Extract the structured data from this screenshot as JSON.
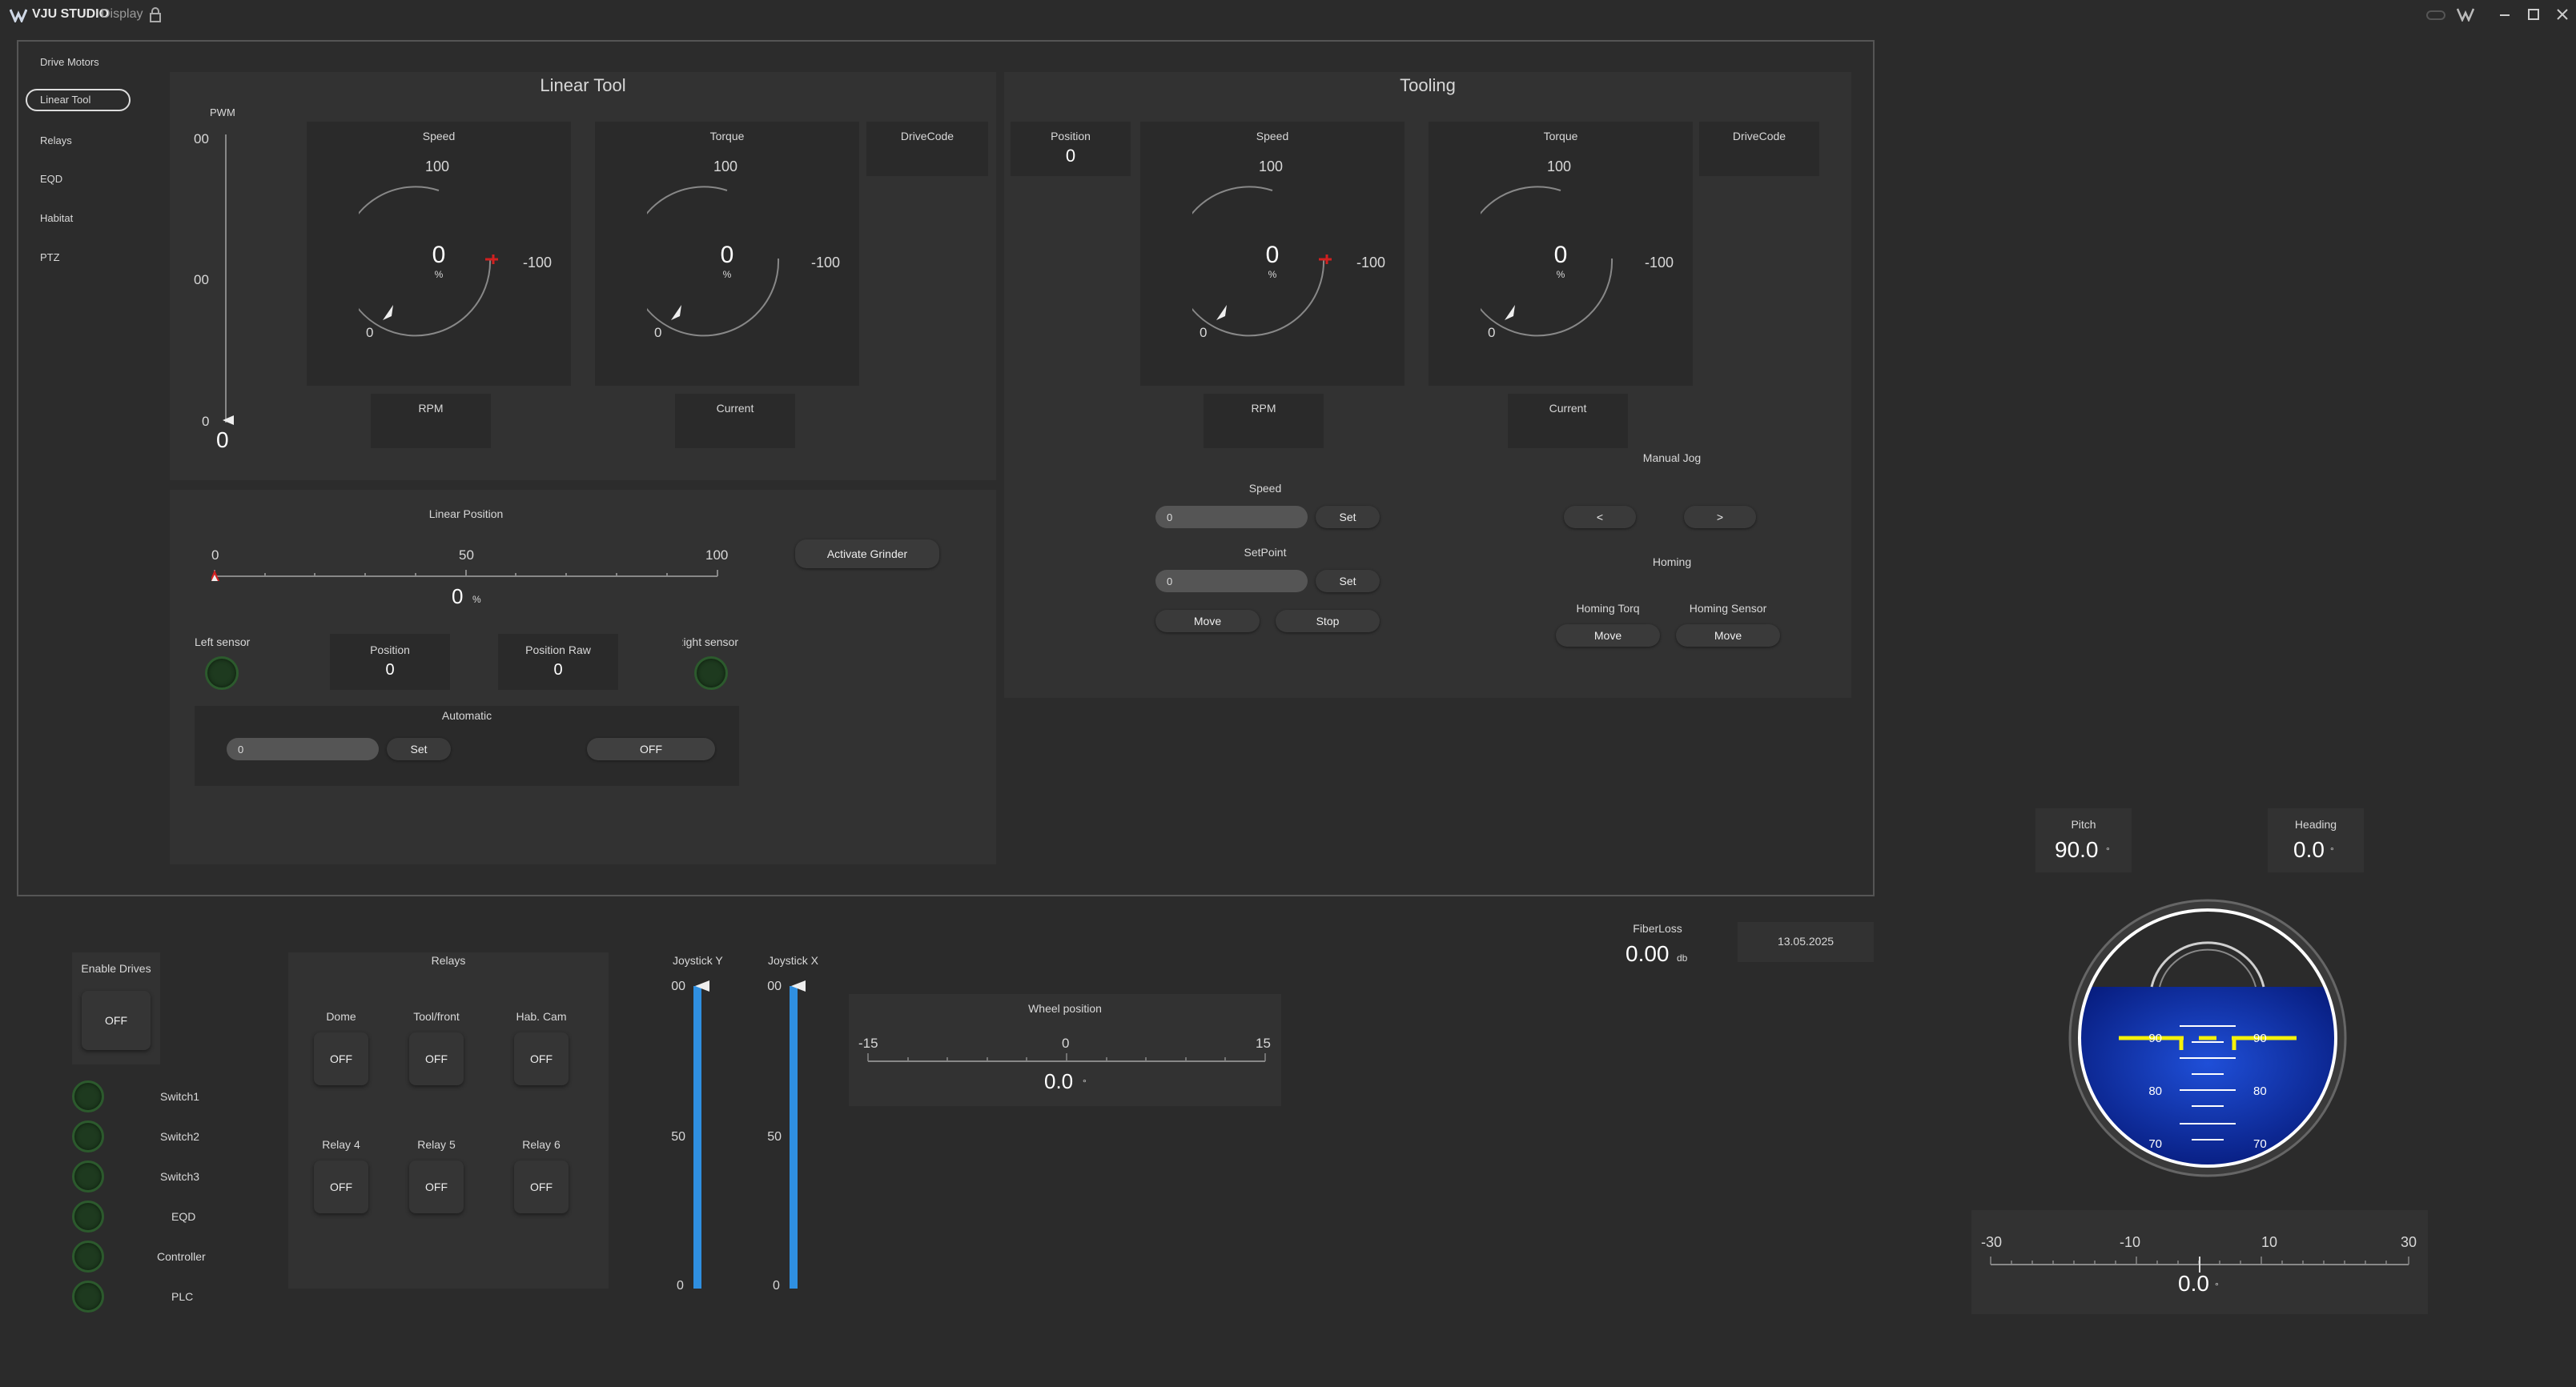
{
  "titlebar": {
    "app": "VJU STUDIO",
    "mode": "Display"
  },
  "sidebar": {
    "items": [
      {
        "label": "Drive Motors"
      },
      {
        "label": "Linear Tool"
      },
      {
        "label": "Relays"
      },
      {
        "label": "EQD"
      },
      {
        "label": "Habitat"
      },
      {
        "label": "PTZ"
      }
    ]
  },
  "linear_tool": {
    "title": "Linear Tool",
    "pwm": {
      "label": "PWM",
      "ticks": [
        "00",
        "00",
        "0"
      ],
      "value": "0"
    },
    "speed": {
      "label": "Speed",
      "max": "100",
      "min": "0",
      "neg": "-100",
      "value": "0",
      "unit": "%",
      "fraction": 0
    },
    "torque": {
      "label": "Torque",
      "max": "100",
      "min": "0",
      "neg": "-100",
      "value": "0",
      "unit": "%",
      "fraction": 0
    },
    "drivecode_label": "DriveCode",
    "rpm_label": "RPM",
    "current_label": "Current",
    "linear_position": {
      "label": "Linear Position",
      "ticks": [
        "0",
        "50",
        "100"
      ],
      "value": "0",
      "unit": "%",
      "fraction": 0
    },
    "activate_grinder": "Activate Grinder",
    "left_sensor": "Left sensor",
    "right_sensor": "Right sensor",
    "position": {
      "label": "Position",
      "value": "0"
    },
    "position_raw": {
      "label": "Position Raw",
      "value": "0"
    },
    "automatic": {
      "label": "Automatic",
      "input": "0",
      "set": "Set",
      "toggle": "OFF"
    }
  },
  "tooling": {
    "title": "Tooling",
    "position": {
      "label": "Position",
      "value": "0"
    },
    "speed": {
      "label": "Speed",
      "max": "100",
      "min": "0",
      "neg": "-100",
      "value": "0",
      "unit": "%",
      "fraction": 0
    },
    "torque": {
      "label": "Torque",
      "max": "100",
      "min": "0",
      "neg": "-100",
      "value": "0",
      "unit": "%",
      "fraction": 0
    },
    "drivecode_label": "DriveCode",
    "rpm_label": "RPM",
    "current_label": "Current",
    "speed_ctrl": {
      "label": "Speed",
      "input": "0",
      "set": "Set"
    },
    "setpoint_ctrl": {
      "label": "SetPoint",
      "input": "0",
      "set": "Set"
    },
    "move": "Move",
    "stop": "Stop",
    "manual_jog": {
      "label": "Manual Jog",
      "left": "<",
      "right": ">"
    },
    "homing": {
      "label": "Homing",
      "torq_label": "Homing Torq",
      "sensor_label": "Homing Sensor",
      "move1": "Move",
      "move2": "Move"
    }
  },
  "enable_drives": {
    "label": "Enable Drives",
    "state": "OFF"
  },
  "switches": [
    {
      "label": "Switch1"
    },
    {
      "label": "Switch2"
    },
    {
      "label": "Switch3"
    },
    {
      "label": "EQD"
    },
    {
      "label": "Controller"
    },
    {
      "label": "PLC"
    }
  ],
  "relays": {
    "title": "Relays",
    "items": [
      {
        "label": "Dome",
        "state": "OFF"
      },
      {
        "label": "Tool/front",
        "state": "OFF"
      },
      {
        "label": "Hab. Cam",
        "state": "OFF"
      },
      {
        "label": "Relay 4",
        "state": "OFF"
      },
      {
        "label": "Relay 5",
        "state": "OFF"
      },
      {
        "label": "Relay 6",
        "state": "OFF"
      }
    ]
  },
  "joystick_y": {
    "label": "Joystick Y",
    "ticks": [
      "00",
      "50",
      "0"
    ]
  },
  "joystick_x": {
    "label": "Joystick X",
    "ticks": [
      "00",
      "50",
      "0"
    ]
  },
  "wheel_position": {
    "label": "Wheel position",
    "ticks": [
      "-15",
      "0",
      "15"
    ],
    "value": "0.0",
    "unit": "°"
  },
  "fiber_loss": {
    "label": "FiberLoss",
    "value": "0.00",
    "unit": "db"
  },
  "date": "13.05.2025",
  "pitch": {
    "label": "Pitch",
    "value": "90.0",
    "unit": "°"
  },
  "heading": {
    "label": "Heading",
    "value": "0.0",
    "unit": "°"
  },
  "attitude": {
    "marks_left": [
      "90",
      "80",
      "70"
    ],
    "marks_right": [
      "90",
      "80",
      "70"
    ]
  },
  "roll_scale": {
    "ticks": [
      "-30",
      "-10",
      "10",
      "30"
    ],
    "value": "0.0",
    "unit": "°"
  },
  "colors": {
    "accent_blue": "#2f8fe0",
    "gauge_red": "#d02020",
    "led_green": "#2c5a2d"
  }
}
